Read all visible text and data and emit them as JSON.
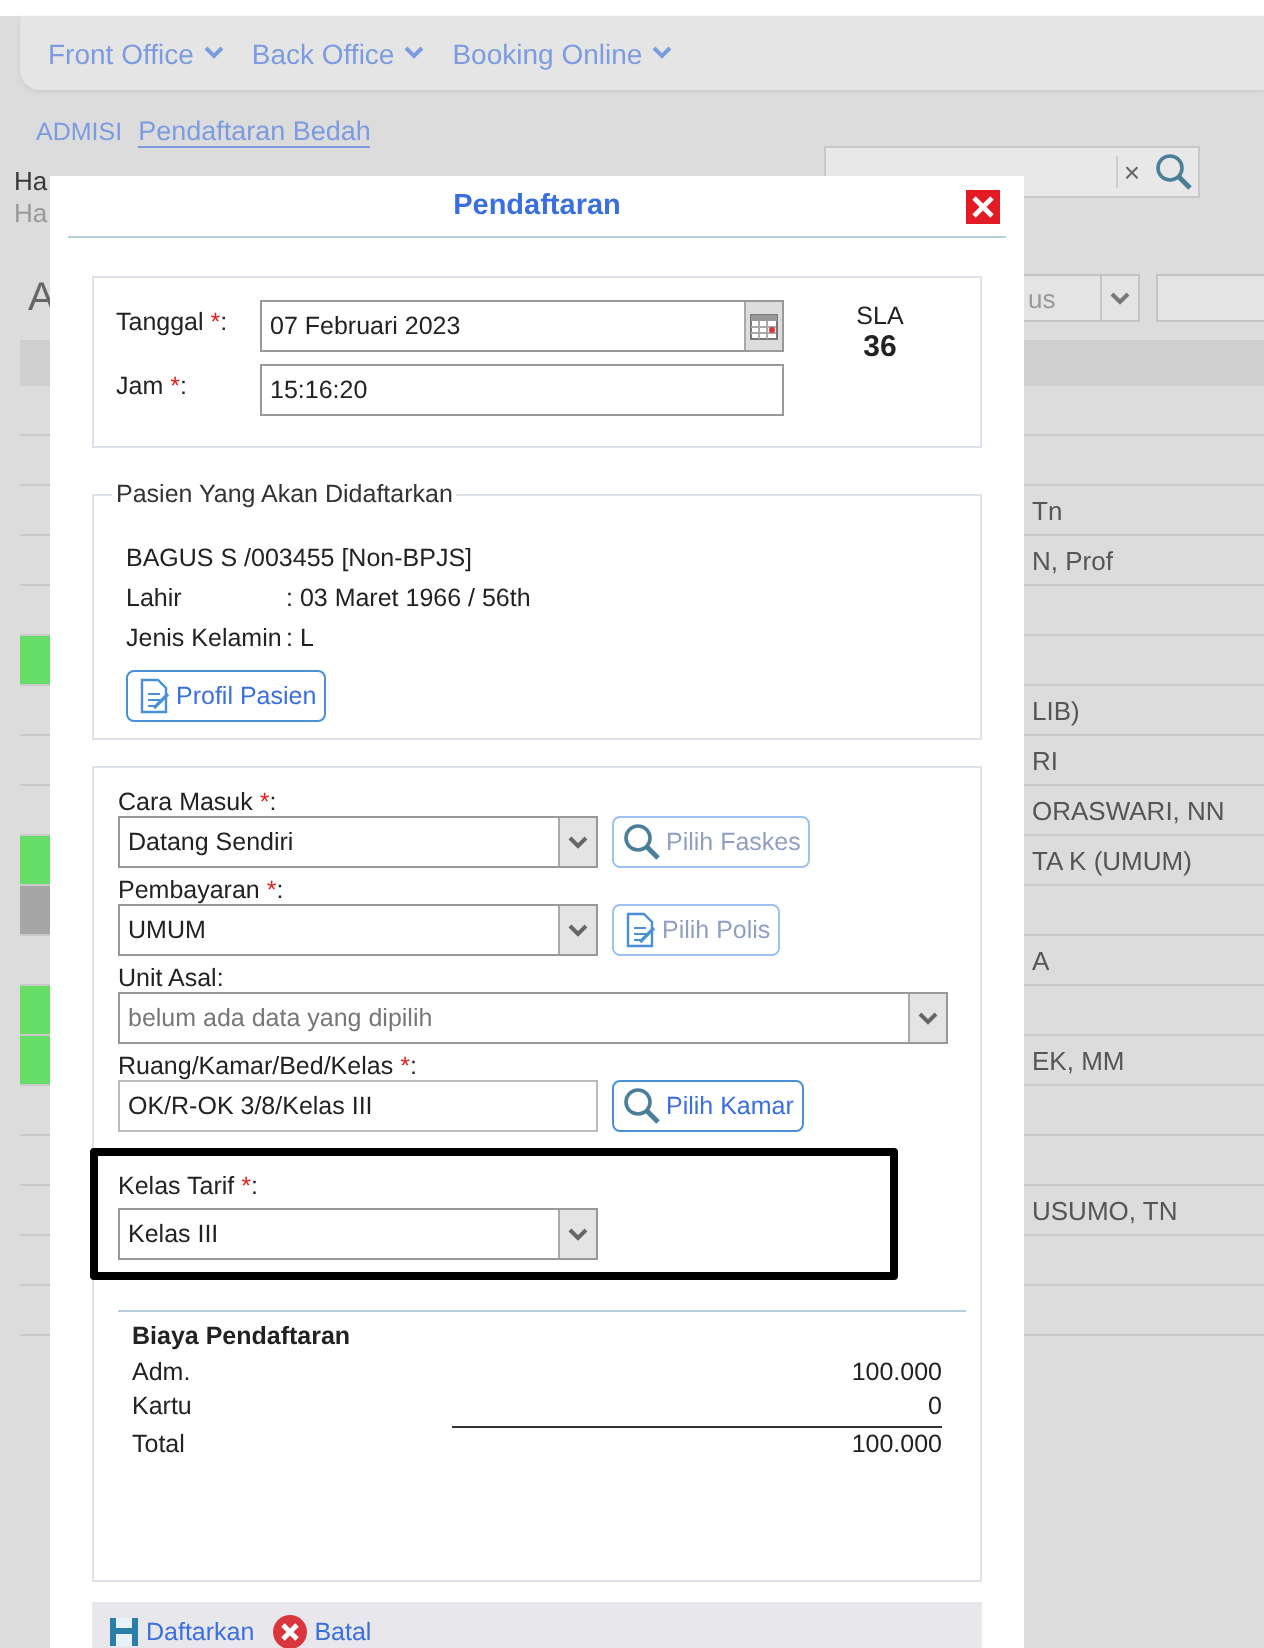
{
  "nav": {
    "menus": [
      {
        "label": "Front Office"
      },
      {
        "label": "Back Office"
      },
      {
        "label": "Booking Online"
      }
    ]
  },
  "breadcrumb": [
    {
      "label": "ADMISI",
      "selected": false
    },
    {
      "label": "Pendaftaran Bedah",
      "selected": true
    }
  ],
  "background": {
    "greeting": "Ha",
    "greeting_sub": "Ha",
    "clear_button": "×",
    "column_header": "A",
    "filter_select": "us",
    "rows": [
      {
        "text": ""
      },
      {
        "text": ""
      },
      {
        "text": "Tn"
      },
      {
        "text": "N, Prof"
      },
      {
        "text": ""
      },
      {
        "text": "",
        "color": "#66dd66"
      },
      {
        "text": "LIB)"
      },
      {
        "text": "RI"
      },
      {
        "text": "ORASWARI, NN"
      },
      {
        "text": "TA K (UMUM)",
        "color": "#66dd66"
      },
      {
        "text": "",
        "color": "#a6a6a6"
      },
      {
        "text": "A"
      },
      {
        "text": "",
        "color": "#66dd66"
      },
      {
        "text": "EK, MM",
        "color": "#66dd66"
      },
      {
        "text": ""
      },
      {
        "text": ""
      },
      {
        "text": "USUMO, TN"
      },
      {
        "text": ""
      },
      {
        "text": ""
      }
    ]
  },
  "dialog": {
    "title": "Pendaftaran",
    "tanggal": {
      "label": "Tanggal",
      "required_mark": "*",
      "label_end": ":",
      "value": "07 Februari 2023"
    },
    "jam": {
      "label": "Jam",
      "required_mark": "*",
      "label_end": ":",
      "value": "15:16:20"
    },
    "sla": {
      "label": "SLA",
      "value": "36"
    },
    "patient": {
      "legend": "Pasien Yang Akan Didaftarkan",
      "name": "BAGUS S /003455 [Non-BPJS]",
      "details": [
        {
          "label": "Lahir",
          "value": ": 03 Maret 1966 / 56th"
        },
        {
          "label": "Jenis Kelamin",
          "value": ": L"
        }
      ],
      "profile_button": "Profil Pasien"
    },
    "fields": [
      {
        "kind": "select",
        "label": "Cara Masuk",
        "required_mark": "*",
        "label_end": ":",
        "value": "Datang Sendiri",
        "button": {
          "label": "Pilih Faskes",
          "disabled": true
        }
      },
      {
        "kind": "select",
        "label": "Pembayaran",
        "required_mark": "*",
        "label_end": ":",
        "value": "UMUM",
        "button": {
          "label": "Pilih Polis",
          "disabled": true
        }
      },
      {
        "kind": "wide-select",
        "label": "Unit Asal",
        "label_end": ":",
        "placeholder": "belum ada data yang dipilih"
      },
      {
        "kind": "input",
        "label": "Ruang/Kamar/Bed/Kelas",
        "required_mark": "*",
        "label_end": ":",
        "value": "OK/R-OK 3/8/Kelas III",
        "button": {
          "label": "Pilih Kamar",
          "disabled": false
        }
      },
      {
        "kind": "select",
        "label": "Kelas Tarif",
        "required_mark": "*",
        "label_end": ":",
        "value": "Kelas III",
        "highlighted": true
      }
    ],
    "costs": {
      "title": "Biaya Pendaftaran",
      "rows": [
        {
          "label": "Adm.",
          "value": "100.000",
          "kind": "item"
        },
        {
          "label": "Kartu",
          "value": "0",
          "kind": "subtotal-line"
        },
        {
          "label": "Total",
          "value": "100.000",
          "kind": "total"
        }
      ]
    },
    "actions": [
      {
        "label": "Daftarkan"
      },
      {
        "label": "Batal"
      }
    ]
  }
}
